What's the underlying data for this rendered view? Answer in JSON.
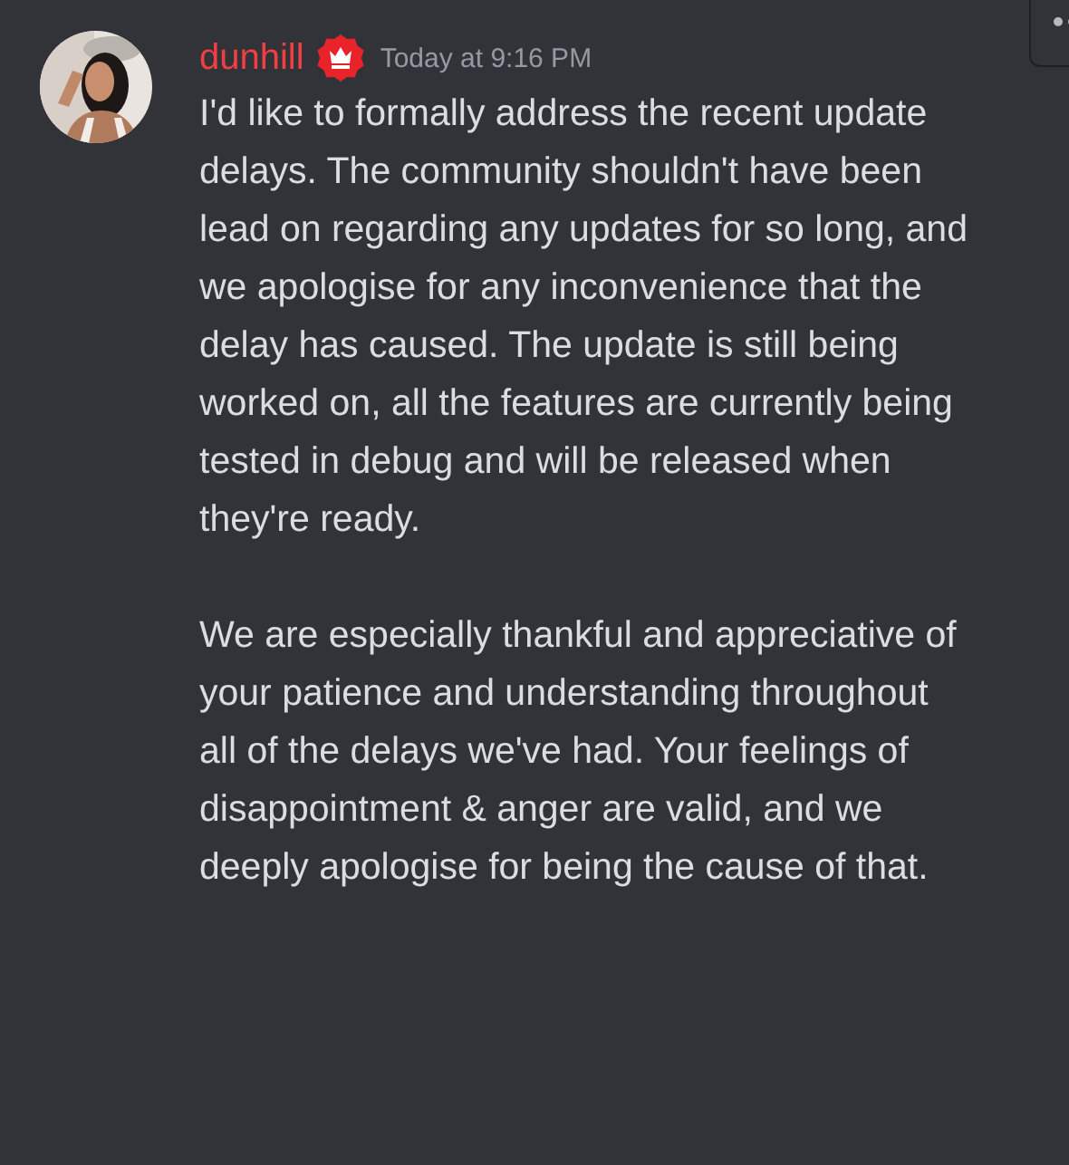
{
  "message": {
    "author": "dunhill",
    "timestamp": "Today at 9:16 PM",
    "paragraphs": [
      "I'd like to formally address the recent update delays. The community shouldn't have been lead on regarding any updates for so long, and we apologise for any inconvenience that the delay has caused. The update is still being worked on, all the features are currently being tested in debug and will be released when they're ready.",
      "We are especially thankful and appreciative of your patience and understanding throughout all of the delays we've had. Your feelings of disappointment & anger are valid, and we deeply apologise for being the cause of that."
    ]
  }
}
